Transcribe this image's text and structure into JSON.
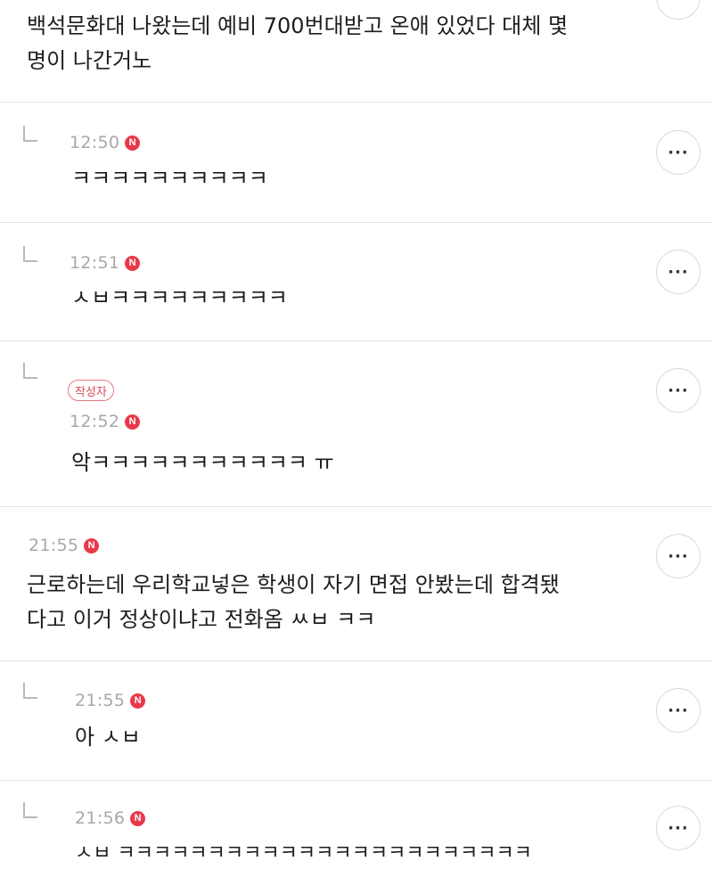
{
  "comments": [
    {
      "text": "백석문화대 나왔는데 예비 700번대받고 온애 있었다 대체 몇\n명이 나간거노"
    },
    {
      "time": "12:50",
      "badge": "N",
      "text": "ㅋㅋㅋㅋㅋㅋㅋㅋㅋㅋ"
    },
    {
      "time": "12:51",
      "badge": "N",
      "text": "ㅅㅂㅋㅋㅋㅋㅋㅋㅋㅋㅋ"
    },
    {
      "author_label": "작성자",
      "time": "12:52",
      "badge": "N",
      "text": "악ㅋㅋㅋㅋㅋㅋㅋㅋㅋㅋㅋ ㅠ"
    },
    {
      "time": "21:55",
      "badge": "N",
      "text": "근로하는데 우리학교넣은 학생이 자기 면접 안봤는데 합격됐\n다고 이거 정상이냐고 전화옴 ㅆㅂ ㅋㅋ"
    },
    {
      "time": "21:55",
      "badge": "N",
      "text": "아 ㅅㅂ"
    },
    {
      "time": "21:56",
      "badge": "N",
      "text": "ㅅㅂ ㅋㅋㅋㅋㅋㅋㅋㅋㅋㅋㅋㅋㅋㅋㅋㅋㅋㅋㅋㅋㅋㅋㅋ"
    }
  ],
  "more_button_label": "···",
  "colors": {
    "accent_badge": "#e8394a",
    "divider": "#e3e3e3",
    "time_text": "#a8a8a8"
  }
}
